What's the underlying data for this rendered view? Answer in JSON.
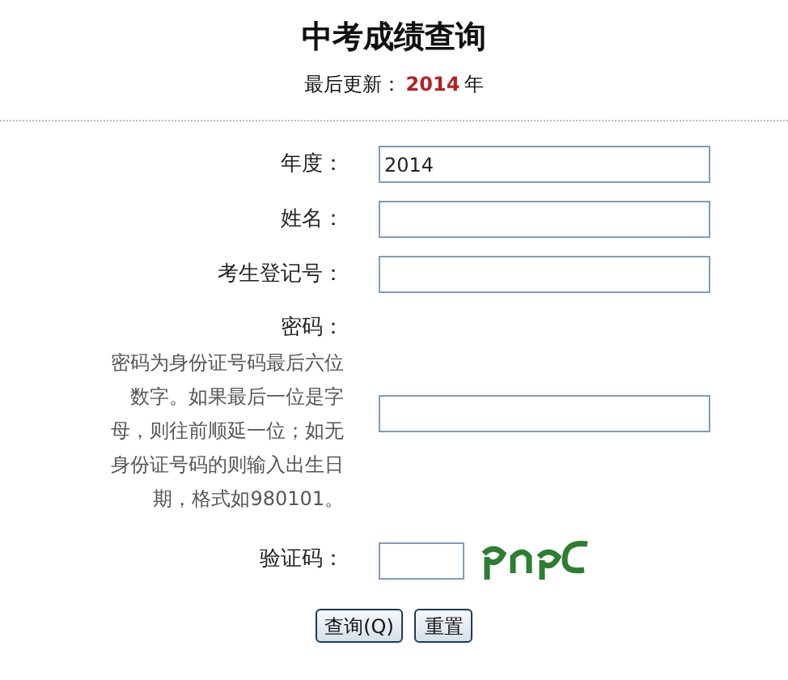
{
  "title": "中考成绩查询",
  "updated": {
    "label": "最后更新：",
    "year": "2014",
    "unit": "年"
  },
  "fields": [
    {
      "kind": "text",
      "label": "年度：",
      "value": "2014"
    },
    {
      "kind": "text",
      "label": "姓名："
    },
    {
      "kind": "text",
      "label": "考生登记号："
    },
    {
      "kind": "password",
      "label": "密码：",
      "hint": "密码为身份证号码最后六位数字。如果最后一位是字母，则往前顺延一位；如无身份证号码的则输入出生日期，格式如980101。"
    },
    {
      "kind": "captcha",
      "label": "验证码："
    }
  ],
  "buttons": [
    "查询(Q)",
    "重置"
  ]
}
